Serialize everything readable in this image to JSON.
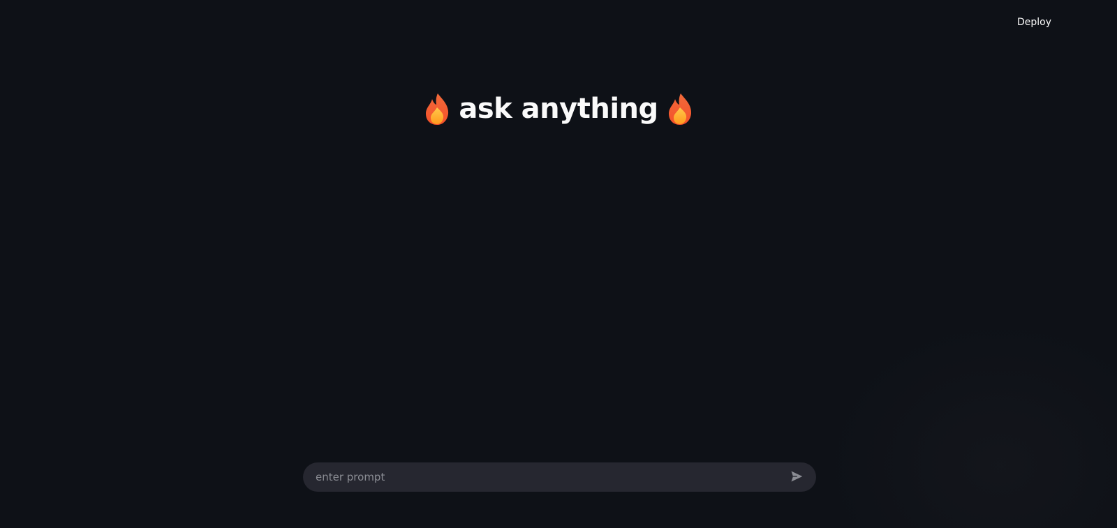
{
  "header": {
    "deploy_label": "Deploy"
  },
  "main": {
    "title": "ask anything",
    "title_icon": "flame-icon"
  },
  "chat": {
    "placeholder": "enter prompt",
    "value": "",
    "send_icon": "send-icon"
  },
  "colors": {
    "background": "#0e1117",
    "input_background": "#262730",
    "text": "#fafafa",
    "placeholder": "#8b8d94",
    "flame_outer": "#f4622a",
    "flame_inner": "#ffb02e"
  }
}
